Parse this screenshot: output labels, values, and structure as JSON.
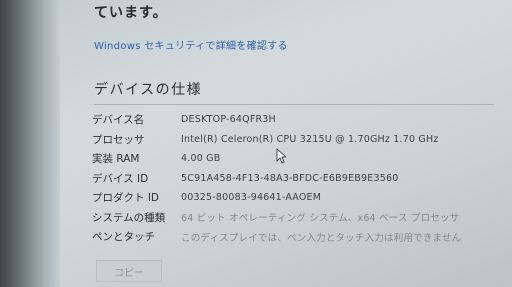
{
  "intro_text": "ています。",
  "security_link": "Windows セキュリティで詳細を確認する",
  "section_title": "デバイスの仕様",
  "specs": [
    {
      "label": "デバイス名",
      "value": "DESKTOP-64QFR3H"
    },
    {
      "label": "プロセッサ",
      "value": "Intel(R) Celeron(R) CPU 3215U @ 1.70GHz   1.70 GHz"
    },
    {
      "label": "実装 RAM",
      "value": "4.00 GB"
    },
    {
      "label": "デバイス ID",
      "value": "5C91A458-4F13-48A3-BFDC-E6B9EB9E3560"
    },
    {
      "label": "プロダクト ID",
      "value": "00325-80083-94641-AAOEM"
    },
    {
      "label": "システムの種類",
      "value": "64 ビット オペレーティング システム、x64 ベース プロセッサ"
    },
    {
      "label": "ペンとタッチ",
      "value": "このディスプレイでは、ペン入力とタッチ入力は利用できません"
    }
  ],
  "copy_button": "コピー",
  "colors": {
    "link": "#2b62b8",
    "text": "#2b3238",
    "background": "#d5dbdd"
  }
}
